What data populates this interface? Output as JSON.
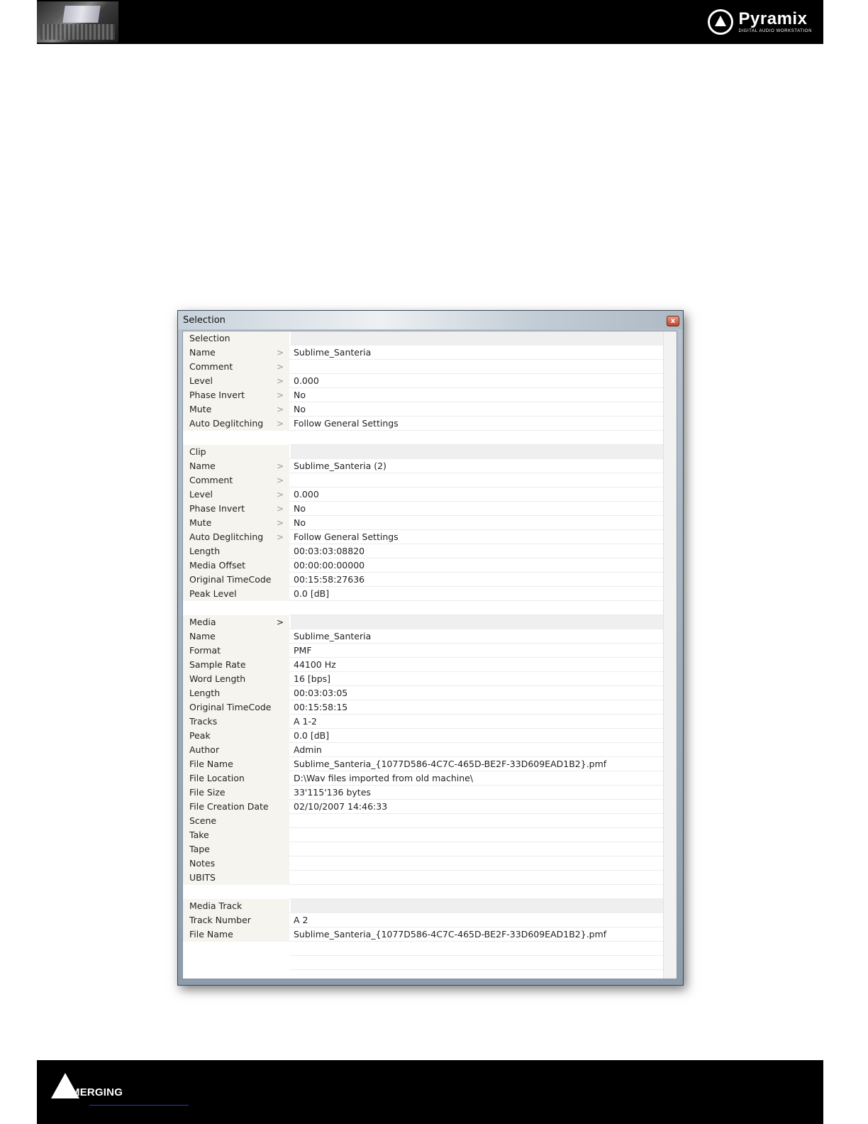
{
  "header": {
    "brand_name": "Pyramix",
    "brand_sub": "DIGITAL AUDIO WORKSTATION"
  },
  "dialog": {
    "title": "Selection",
    "close_glyph": "x",
    "sections": [
      {
        "title": "Selection",
        "has_arrow": false,
        "rows": [
          {
            "label": "Name",
            "arrow": ">",
            "value": "Sublime_Santeria"
          },
          {
            "label": "Comment",
            "arrow": ">",
            "value": ""
          },
          {
            "label": "Level",
            "arrow": ">",
            "value": "0.000"
          },
          {
            "label": "Phase Invert",
            "arrow": ">",
            "value": "No"
          },
          {
            "label": "Mute",
            "arrow": ">",
            "value": "No"
          },
          {
            "label": "Auto Deglitching",
            "arrow": ">",
            "value": "Follow General Settings"
          }
        ]
      },
      {
        "title": "Clip",
        "has_arrow": false,
        "rows": [
          {
            "label": "Name",
            "arrow": ">",
            "value": "Sublime_Santeria (2)"
          },
          {
            "label": "Comment",
            "arrow": ">",
            "value": ""
          },
          {
            "label": "Level",
            "arrow": ">",
            "value": "0.000"
          },
          {
            "label": "Phase Invert",
            "arrow": ">",
            "value": "No"
          },
          {
            "label": "Mute",
            "arrow": ">",
            "value": "No"
          },
          {
            "label": "Auto Deglitching",
            "arrow": ">",
            "value": "Follow General Settings"
          },
          {
            "label": "Length",
            "arrow": "",
            "value": "00:03:03:08820"
          },
          {
            "label": "Media Offset",
            "arrow": "",
            "value": "00:00:00:00000"
          },
          {
            "label": "Original TimeCode",
            "arrow": "",
            "value": "00:15:58:27636"
          },
          {
            "label": "Peak Level",
            "arrow": "",
            "value": "0.0 [dB]"
          }
        ]
      },
      {
        "title": "Media",
        "has_arrow": true,
        "arrow": ">",
        "rows": [
          {
            "label": "Name",
            "arrow": "",
            "value": "Sublime_Santeria"
          },
          {
            "label": "Format",
            "arrow": "",
            "value": "PMF"
          },
          {
            "label": "Sample Rate",
            "arrow": "",
            "value": "44100 Hz"
          },
          {
            "label": "Word Length",
            "arrow": "",
            "value": "16 [bps]"
          },
          {
            "label": "Length",
            "arrow": "",
            "value": "00:03:03:05"
          },
          {
            "label": "Original TimeCode",
            "arrow": "",
            "value": "00:15:58:15"
          },
          {
            "label": "Tracks",
            "arrow": "",
            "value": "A 1-2"
          },
          {
            "label": "Peak",
            "arrow": "",
            "value": "0.0 [dB]"
          },
          {
            "label": "Author",
            "arrow": "",
            "value": "Admin"
          },
          {
            "label": "File Name",
            "arrow": "",
            "value": "Sublime_Santeria_{1077D586-4C7C-465D-BE2F-33D609EAD1B2}.pmf"
          },
          {
            "label": "File Location",
            "arrow": "",
            "value": "D:\\Wav files imported from old machine\\"
          },
          {
            "label": "File Size",
            "arrow": "",
            "value": "33'115'136 bytes"
          },
          {
            "label": "File Creation Date",
            "arrow": "",
            "value": "02/10/2007 14:46:33"
          },
          {
            "label": "Scene",
            "arrow": "",
            "value": ""
          },
          {
            "label": "Take",
            "arrow": "",
            "value": ""
          },
          {
            "label": "Tape",
            "arrow": "",
            "value": ""
          },
          {
            "label": "Notes",
            "arrow": "",
            "value": ""
          },
          {
            "label": "UBITS",
            "arrow": "",
            "value": ""
          }
        ]
      },
      {
        "title": "Media Track",
        "has_arrow": false,
        "rows": [
          {
            "label": "Track Number",
            "arrow": "",
            "value": "A 2"
          },
          {
            "label": "File Name",
            "arrow": "",
            "value": "Sublime_Santeria_{1077D586-4C7C-465D-BE2F-33D609EAD1B2}.pmf"
          }
        ]
      }
    ]
  },
  "footer": {
    "brand_name": "MERGING"
  }
}
